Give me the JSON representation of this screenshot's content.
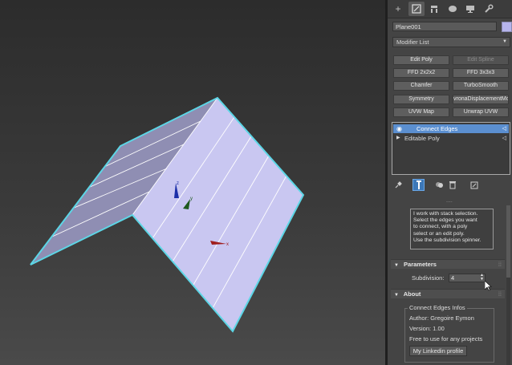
{
  "viewport": {
    "gizmo_labels": {
      "z": "z",
      "y": "y",
      "x": "x"
    },
    "colors": {
      "mesh_light": "#c9c7f1",
      "mesh_dark": "#8f8eb3",
      "outline": "#5cd6e6",
      "edge": "#ffffff"
    }
  },
  "command_panel": {
    "tabs": [
      {
        "icon": "create-icon",
        "glyph": "+"
      },
      {
        "icon": "modify-icon",
        "glyph": "⬒"
      },
      {
        "icon": "hierarchy-icon",
        "glyph": "⊓"
      },
      {
        "icon": "motion-icon",
        "glyph": "●"
      },
      {
        "icon": "display-icon",
        "glyph": "▬"
      },
      {
        "icon": "utilities-icon",
        "glyph": "🔧"
      }
    ],
    "object_name": "Plane001",
    "object_color": "#b6b4ec",
    "modifier_list_label": "Modifier List",
    "modifier_buttons": [
      {
        "label": "Edit Poly",
        "enabled": true
      },
      {
        "label": "Edit Spline",
        "enabled": false
      },
      {
        "label": "FFD 2x2x2",
        "enabled": true
      },
      {
        "label": "FFD 3x3x3",
        "enabled": true
      },
      {
        "label": "Chamfer",
        "enabled": true
      },
      {
        "label": "TurboSmooth",
        "enabled": true
      },
      {
        "label": "Symmetry",
        "enabled": true
      },
      {
        "label": "vronaDisplacementMo",
        "enabled": true
      },
      {
        "label": "UVW Map",
        "enabled": true
      },
      {
        "label": "Unwrap UVW",
        "enabled": true
      }
    ],
    "stack": [
      {
        "label": "Connect Edges",
        "selected": true
      },
      {
        "label": "Editable Poly",
        "selected": false
      }
    ],
    "stack_tools": [
      "pin-stack-icon",
      "show-end-result-icon",
      "make-unique-icon",
      "remove-modifier-icon",
      "configure-modifier-sets-icon"
    ],
    "separator": "....",
    "tooltip_lines": [
      "I work with stack selection.",
      "Select the edges you want",
      "to connect, with a poly",
      "select or an edit poly.",
      "Use the subdivision spinner."
    ],
    "parameters": {
      "title": "Parameters",
      "subdivision_label": "Subdivision:",
      "subdivision_value": "4"
    },
    "about": {
      "title": "About",
      "group_title": "Connect Edges Infos",
      "author": "Author: Gregoire Eymon",
      "version": "Version: 1.00",
      "license": "Free to use for any projects",
      "linkedin_button": "My Linkedin profile"
    }
  }
}
